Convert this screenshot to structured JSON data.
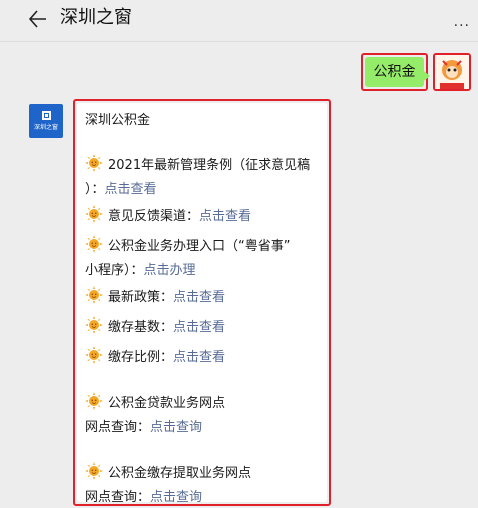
{
  "header": {
    "title": "深圳之窗",
    "more": "..."
  },
  "outgoing": {
    "text": "公积金"
  },
  "bot": {
    "avatar_text": "深圳之窗"
  },
  "message": {
    "heading": "深圳公积金",
    "items": [
      {
        "text": "2021年最新管理条例（征求意见稿",
        "cont": "）：",
        "link": "点击查看"
      },
      {
        "text": "意见反馈渠道：",
        "link": "点击查看"
      },
      {
        "text": "公积金业务办理入口（“粤省事”",
        "cont": "小程序）：",
        "link": "点击办理"
      },
      {
        "text": "最新政策：",
        "link": "点击查看"
      },
      {
        "text": "缴存基数：",
        "link": "点击查看"
      },
      {
        "text": "缴存比例：",
        "link": "点击查看"
      }
    ],
    "sections": [
      {
        "text": "公积金贷款业务网点",
        "label": "网点查询：",
        "link": "点击查询"
      },
      {
        "text": "公积金缴存提取业务网点",
        "label": "网点查询：",
        "link": "点击查询"
      }
    ]
  },
  "colors": {
    "highlight": "#e0212b",
    "bubble_green": "#95ec69",
    "link": "#576b95",
    "avatar_blue": "#1f64c8"
  }
}
